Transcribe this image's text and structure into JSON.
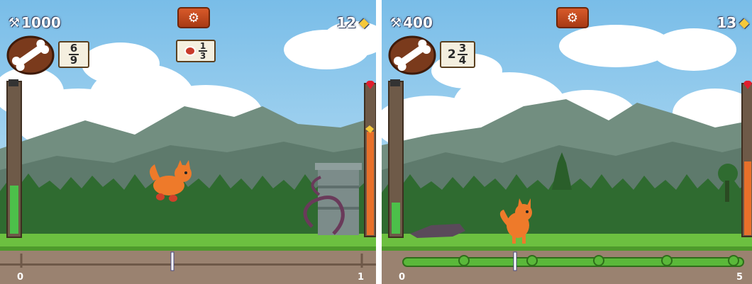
{
  "left": {
    "score": "1000",
    "coins": "12",
    "card": {
      "num": "6",
      "den": "9"
    },
    "target": {
      "num": "1",
      "den": "3"
    },
    "axis_start": "0",
    "axis_end": "1"
  },
  "right": {
    "score": "400",
    "coins": "13",
    "card": {
      "whole": "2",
      "num": "3",
      "den": "4"
    },
    "axis_start": "0",
    "axis_end": "5"
  },
  "colors": {
    "sky": "#8cc8ec",
    "mountain": "#6e8a78",
    "forest": "#2e6a30",
    "grass": "#6cc040",
    "road": "#9a8270",
    "health_bar": "#e8702a",
    "progress_bar": "#4cc04a",
    "button": "#c84a1e"
  }
}
